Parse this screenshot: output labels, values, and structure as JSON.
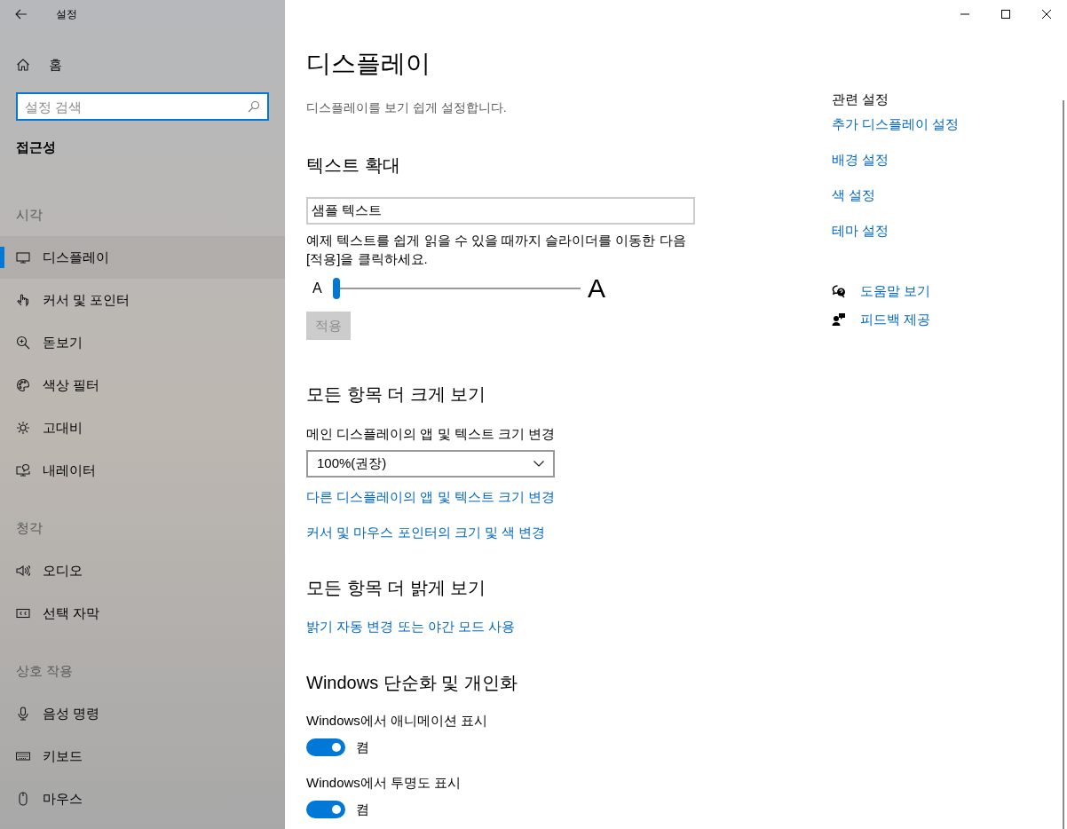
{
  "window": {
    "title": "설정"
  },
  "sidebar": {
    "home": {
      "label": "홈"
    },
    "search": {
      "placeholder": "설정 검색"
    },
    "section_title": "접근성",
    "groups": [
      {
        "heading": "시각",
        "items": [
          {
            "label": "디스플레이",
            "selected": true
          },
          {
            "label": "커서 및 포인터",
            "selected": false
          },
          {
            "label": "돋보기",
            "selected": false
          },
          {
            "label": "색상 필터",
            "selected": false
          },
          {
            "label": "고대비",
            "selected": false
          },
          {
            "label": "내레이터",
            "selected": false
          }
        ]
      },
      {
        "heading": "청각",
        "items": [
          {
            "label": "오디오",
            "selected": false
          },
          {
            "label": "선택 자막",
            "selected": false
          }
        ]
      },
      {
        "heading": "상호 작용",
        "items": [
          {
            "label": "음성 명령",
            "selected": false
          },
          {
            "label": "키보드",
            "selected": false
          },
          {
            "label": "마우스",
            "selected": false
          }
        ]
      }
    ]
  },
  "main": {
    "title": "디스플레이",
    "description": "디스플레이를 보기 쉽게 설정합니다.",
    "text_size": {
      "heading": "텍스트 확대",
      "sample_field": {
        "value": "샘플 텍스트"
      },
      "hint": "예제 텍스트를 쉽게 읽을 수 있을 때까지 슬라이더를 이동한 다음 [적용]을 클릭하세요.",
      "slider": {
        "small_label": "A",
        "large_label": "A",
        "level": 0
      },
      "apply_button": {
        "label": "적용",
        "disabled": true
      }
    },
    "bigger": {
      "heading": "모든 항목 더 크게 보기",
      "dropdown_label": "메인 디스플레이의 앱 및 텍스트 크기 변경",
      "dropdown": {
        "value": "100%(권장)"
      },
      "links": [
        "다른 디스플레이의 앱 및 텍스트 크기 변경",
        "커서 및 마우스 포인터의 크기 및 색 변경"
      ]
    },
    "brighter": {
      "heading": "모든 항목 더 밝게 보기",
      "links": [
        "밝기 자동 변경 또는 야간 모드 사용"
      ]
    },
    "simplify": {
      "heading": "Windows 단순화 및 개인화",
      "toggles": [
        {
          "label": "Windows에서 애니메이션 표시",
          "on": true,
          "state_text": "켬"
        },
        {
          "label": "Windows에서 투명도 표시",
          "on": true,
          "state_text": "켬"
        }
      ]
    }
  },
  "related": {
    "heading": "관련 설정",
    "links": [
      "추가 디스플레이 설정",
      "배경 설정",
      "색 설정",
      "테마 설정"
    ],
    "help": [
      {
        "label": "도움말 보기"
      },
      {
        "label": "피드백 제공"
      }
    ]
  }
}
